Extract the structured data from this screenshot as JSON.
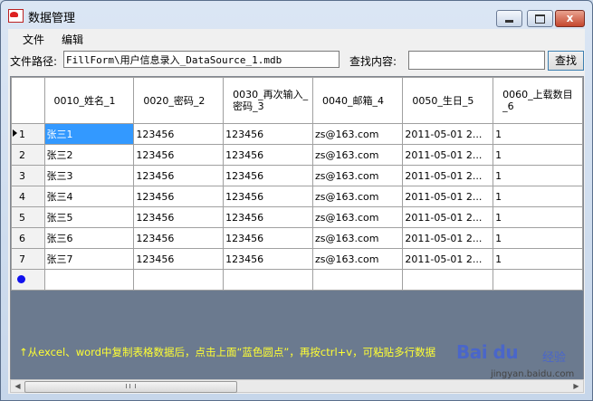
{
  "window": {
    "title": "数据管理",
    "minimize_label": "_",
    "maximize_label": "□",
    "close_label": "x"
  },
  "menu": {
    "file": "文件",
    "edit": "编辑"
  },
  "toolbar": {
    "path_label": "文件路径:",
    "path_value": "FillForm\\用户信息录入_DataSource_1.mdb",
    "search_label": "查找内容:",
    "search_value": "",
    "search_button": "查找"
  },
  "grid": {
    "columns": [
      "0010_姓名_1",
      "0020_密码_2",
      "0030_再次输入_密码_3",
      "0040_邮箱_4",
      "0050_生日_5",
      "0060_上载数目_6"
    ],
    "rows": [
      {
        "num": "1",
        "cells": [
          "张三1",
          "123456",
          "123456",
          "zs@163.com",
          "2011-05-01 2...",
          "1"
        ]
      },
      {
        "num": "2",
        "cells": [
          "张三2",
          "123456",
          "123456",
          "zs@163.com",
          "2011-05-01 2...",
          "1"
        ]
      },
      {
        "num": "3",
        "cells": [
          "张三3",
          "123456",
          "123456",
          "zs@163.com",
          "2011-05-01 2...",
          "1"
        ]
      },
      {
        "num": "4",
        "cells": [
          "张三4",
          "123456",
          "123456",
          "zs@163.com",
          "2011-05-01 2...",
          "1"
        ]
      },
      {
        "num": "5",
        "cells": [
          "张三5",
          "123456",
          "123456",
          "zs@163.com",
          "2011-05-01 2...",
          "1"
        ]
      },
      {
        "num": "6",
        "cells": [
          "张三6",
          "123456",
          "123456",
          "zs@163.com",
          "2011-05-01 2...",
          "1"
        ]
      },
      {
        "num": "7",
        "cells": [
          "张三7",
          "123456",
          "123456",
          "zs@163.com",
          "2011-05-01 2...",
          "1"
        ]
      }
    ],
    "hint": "↑从excel、word中复制表格数据后，点击上面“蓝色圆点”，再按ctrl+v，可粘贴多行数据",
    "colors": {
      "selected": "#3399ff",
      "background": "#6b7a8f",
      "hint": "#ffff33",
      "new_row_dot": "#1111ee"
    }
  },
  "watermark": {
    "brand": "Bai du",
    "sub": "经验",
    "url": "jingyan.baidu.com"
  }
}
